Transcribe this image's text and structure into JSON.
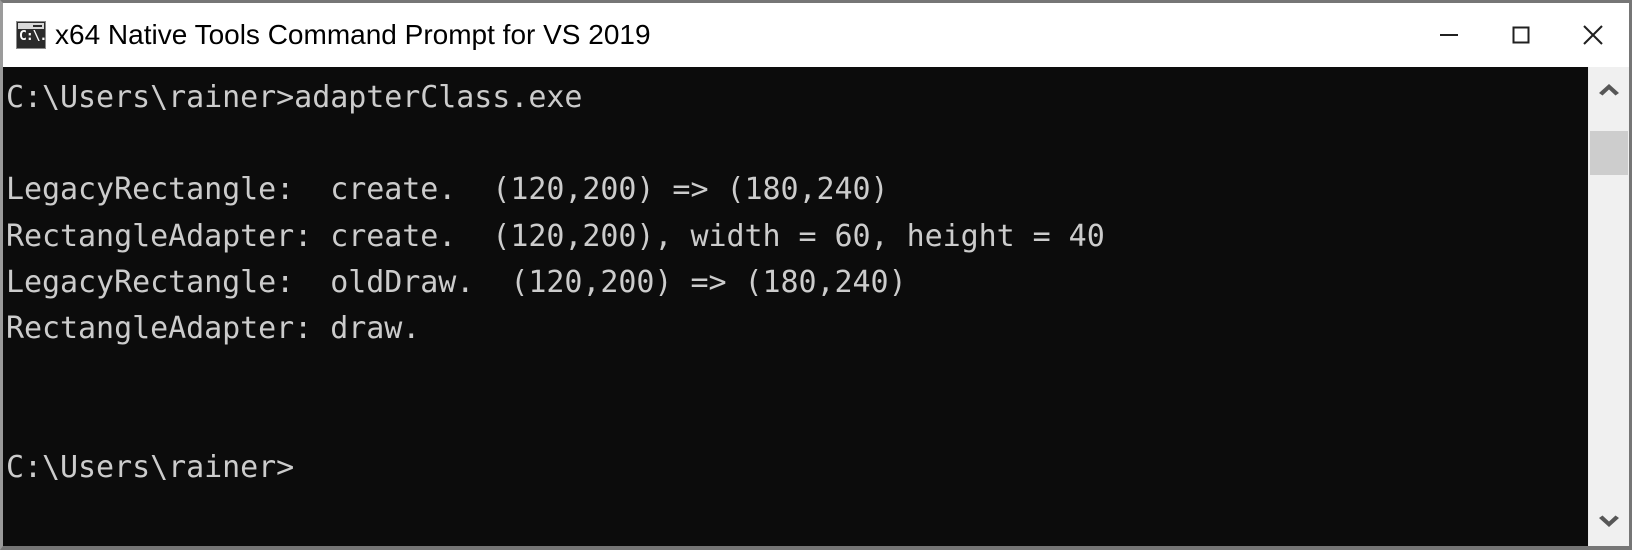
{
  "window": {
    "title": "x64 Native Tools Command Prompt for VS 2019",
    "icon_name": "command-prompt-icon",
    "icon_text": "C:\\.",
    "controls": {
      "minimize_label": "Minimize",
      "maximize_label": "Maximize",
      "close_label": "Close"
    }
  },
  "console": {
    "background_color": "#0c0c0c",
    "text_color": "#cccccc",
    "lines": [
      "C:\\Users\\rainer>adapterClass.exe",
      "",
      "LegacyRectangle:  create.  (120,200) => (180,240)",
      "RectangleAdapter: create.  (120,200), width = 60, height = 40",
      "LegacyRectangle:  oldDraw.  (120,200) => (180,240)",
      "RectangleAdapter: draw.",
      "",
      "",
      "C:\\Users\\rainer>"
    ],
    "text": "C:\\Users\\rainer>adapterClass.exe\n\nLegacyRectangle:  create.  (120,200) => (180,240)\nRectangleAdapter: create.  (120,200), width = 60, height = 40\nLegacyRectangle:  oldDraw.  (120,200) => (180,240)\nRectangleAdapter: draw.\n\n\nC:\\Users\\rainer>"
  },
  "scrollbar": {
    "up_icon": "chevron-up-icon",
    "down_icon": "chevron-down-icon",
    "track_color": "#f0f0f0",
    "thumb_color": "#cdcdcd"
  }
}
